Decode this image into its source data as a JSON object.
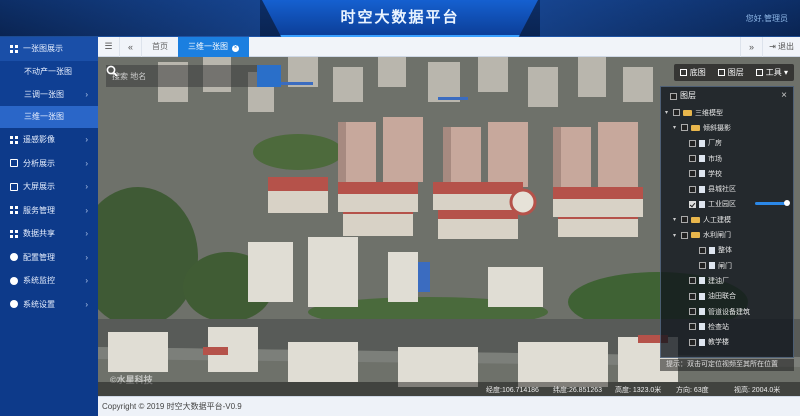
{
  "header": {
    "title": "时空大数据平台",
    "user": "您好,管理员"
  },
  "sidebar": {
    "items": [
      {
        "label": "一张图展示",
        "icon": "grid-icon"
      },
      {
        "label": "遥感影像",
        "icon": "image-icon"
      },
      {
        "label": "分析展示",
        "icon": "analysis-icon"
      },
      {
        "label": "大屏展示",
        "icon": "screen-icon"
      },
      {
        "label": "服务管理",
        "icon": "service-icon"
      },
      {
        "label": "数据共享",
        "icon": "share-icon"
      },
      {
        "label": "配置管理",
        "icon": "wrench-icon"
      },
      {
        "label": "系统监控",
        "icon": "monitor-icon"
      },
      {
        "label": "系统设置",
        "icon": "gear-icon"
      }
    ],
    "subitems": [
      {
        "label": "不动产一张图"
      },
      {
        "label": "三调一张图"
      },
      {
        "label": "三维一张图"
      }
    ]
  },
  "tabbar": {
    "home": "首页",
    "active_tab": "三维一张图",
    "logout": "退出"
  },
  "map": {
    "search_placeholder": "搜索 地名",
    "tools": {
      "basemap": "底图",
      "layers": "图层",
      "tools": "工具"
    },
    "layer_panel": {
      "title": "图层",
      "rows": [
        {
          "label": "三维模型",
          "type": "root",
          "checked": false
        },
        {
          "label": "倾斜摄影",
          "type": "folder",
          "checked": false
        },
        {
          "label": "厂房",
          "type": "file",
          "checked": false
        },
        {
          "label": "市场",
          "type": "file",
          "checked": false
        },
        {
          "label": "学校",
          "type": "file",
          "checked": false
        },
        {
          "label": "县城社区",
          "type": "file",
          "checked": false
        },
        {
          "label": "工业园区",
          "type": "file",
          "checked": true
        },
        {
          "label": "人工建模",
          "type": "folder",
          "checked": false
        },
        {
          "label": "水利闸门",
          "type": "folder",
          "checked": false
        },
        {
          "label": "整体",
          "type": "file2",
          "checked": false
        },
        {
          "label": "闸门",
          "type": "file2",
          "checked": false
        },
        {
          "label": "建油厂",
          "type": "file",
          "checked": false
        },
        {
          "label": "油田联合",
          "type": "file",
          "checked": false
        },
        {
          "label": "管道设备建筑",
          "type": "file",
          "checked": false
        },
        {
          "label": "检查站",
          "type": "file",
          "checked": false
        },
        {
          "label": "教学楼",
          "type": "file",
          "checked": false
        }
      ]
    },
    "tip": "提示：双击可定位视频至其所在位置",
    "watermark": "©水星科技",
    "status": {
      "lon": "经度:106.714186",
      "lat": "纬度:26.851263",
      "height": "高度: 1323.0米",
      "heading": "方向: 63度",
      "view": "视高: 2004.0米"
    }
  },
  "footer": {
    "copyright": "Copyright © 2019 时空大数据平台-V0.9"
  },
  "colors": {
    "header": "#0a2452",
    "sidebar": "#0d3a8a",
    "accent": "#1b7fe0"
  }
}
